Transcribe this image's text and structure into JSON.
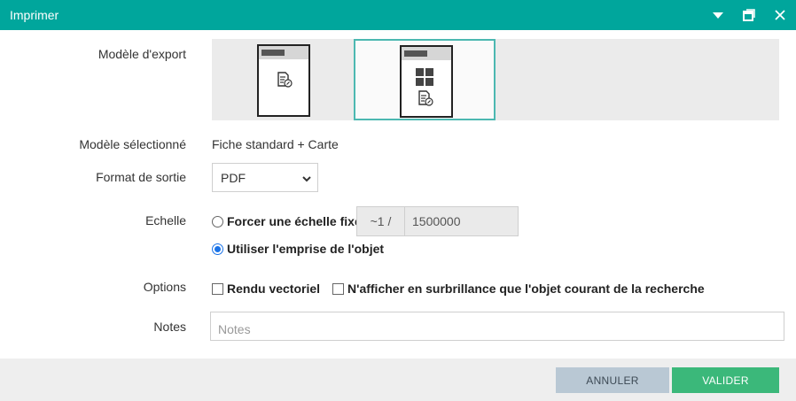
{
  "window": {
    "title": "Imprimer"
  },
  "labels": {
    "export_model": "Modèle d'export",
    "selected_model": "Modèle sélectionné",
    "output_format": "Format de sortie",
    "scale": "Echelle",
    "options": "Options",
    "notes": "Notes"
  },
  "export_models": [
    {
      "icon": "document-edit-icon",
      "selected": false
    },
    {
      "icon": "grid-document-icon",
      "selected": true
    }
  ],
  "selected_model_value": "Fiche standard + Carte",
  "output_format": {
    "value": "PDF"
  },
  "scale": {
    "force_label": "Forcer une échelle fixe",
    "prefix": "~1 /",
    "value": "1500000",
    "use_extent_label": "Utiliser l'emprise de l'objet",
    "selected": "use_extent"
  },
  "options": {
    "vector_label": "Rendu vectoriel",
    "highlight_label": "N'afficher en surbrillance que l'objet courant de la recherche"
  },
  "notes": {
    "placeholder": "Notes"
  },
  "footer": {
    "cancel": "ANNULER",
    "ok": "VALIDER"
  },
  "colors": {
    "titlebar": "#00a69c",
    "selected_border": "#4cb8b1",
    "ok_button": "#3bb87a",
    "cancel_button": "#b9c8d4"
  }
}
